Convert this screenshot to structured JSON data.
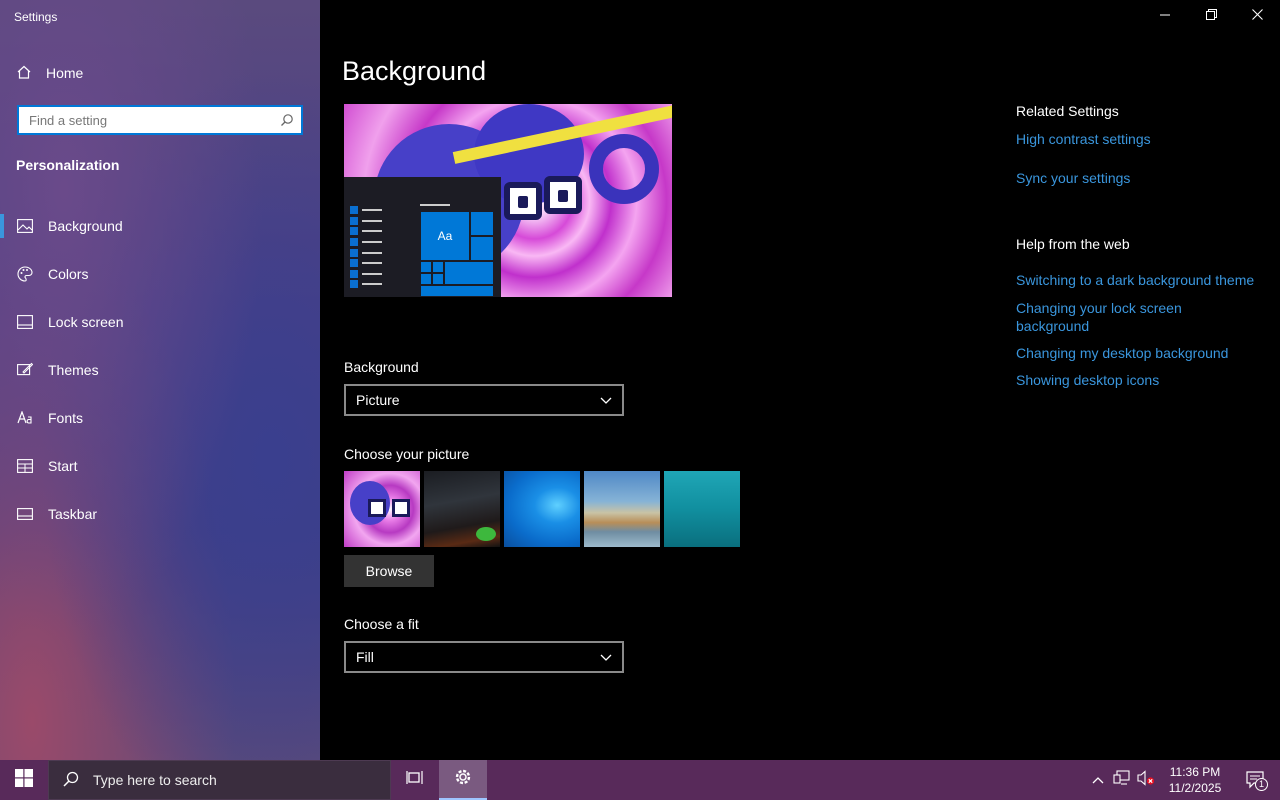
{
  "window": {
    "title": "Settings",
    "controls": {
      "minimize": "minimize-icon",
      "restore": "restore-icon",
      "close": "close-icon"
    }
  },
  "sidebar": {
    "home_label": "Home",
    "search_placeholder": "Find a setting",
    "section_title": "Personalization",
    "items": [
      {
        "label": "Background",
        "icon": "picture-icon",
        "active": true
      },
      {
        "label": "Colors",
        "icon": "palette-icon",
        "active": false
      },
      {
        "label": "Lock screen",
        "icon": "lock-screen-icon",
        "active": false
      },
      {
        "label": "Themes",
        "icon": "themes-icon",
        "active": false
      },
      {
        "label": "Fonts",
        "icon": "fonts-icon",
        "active": false
      },
      {
        "label": "Start",
        "icon": "start-icon",
        "active": false
      },
      {
        "label": "Taskbar",
        "icon": "taskbar-icon",
        "active": false
      }
    ]
  },
  "main": {
    "title": "Background",
    "preview_tile_text": "Aa",
    "background_label": "Background",
    "background_value": "Picture",
    "choose_picture_label": "Choose your picture",
    "browse_label": "Browse",
    "fit_label": "Choose a fit",
    "fit_value": "Fill"
  },
  "related": {
    "title": "Related Settings",
    "links": [
      "High contrast settings",
      "Sync your settings"
    ]
  },
  "help": {
    "title": "Help from the web",
    "links": [
      "Switching to a dark background theme",
      "Changing your lock screen background",
      "Changing my desktop background",
      "Showing desktop icons"
    ]
  },
  "taskbar": {
    "search_placeholder": "Type here to search",
    "time": "11:36 PM",
    "date": "11/2/2025",
    "notification_count": "1"
  },
  "colors": {
    "accent": "#0078d7",
    "link": "#3a96dd",
    "taskbar": "#582a5a"
  }
}
